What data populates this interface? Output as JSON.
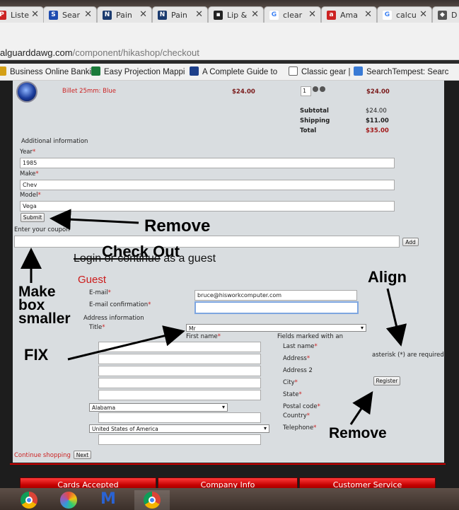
{
  "browser": {
    "tabs": [
      {
        "label": "Liste",
        "icon": "pinterest-icon",
        "color": "#cc2222"
      },
      {
        "label": "Sear",
        "icon": "search-ext-icon",
        "color": "#1d4bb0"
      },
      {
        "label": "Pain",
        "icon": "paint-icon",
        "color": "#1b3b6f"
      },
      {
        "label": "Pain",
        "icon": "paint-icon",
        "color": "#1b3b6f"
      },
      {
        "label": "Lip &",
        "icon": "dark-square-icon",
        "color": "#222222"
      },
      {
        "label": "clear",
        "icon": "google-icon",
        "color": "#4285f4"
      },
      {
        "label": "Ama",
        "icon": "amazon-icon",
        "color": "#cc2222"
      },
      {
        "label": "calcu",
        "icon": "google-icon",
        "color": "#4285f4"
      },
      {
        "label": "D",
        "icon": "car-icon",
        "color": "#555555"
      }
    ],
    "url_host": "alguarddawg.com",
    "url_path": "/component/hikashop/checkout",
    "bookmarks": [
      {
        "label": "Business Online Banki",
        "icon": "bank-icon",
        "color": "#d4a017"
      },
      {
        "label": "Easy Projection Mappi",
        "icon": "projection-icon",
        "color": "#1a7a3a"
      },
      {
        "label": "A Complete Guide to",
        "icon": "guide-icon",
        "color": "#1d3f8a"
      },
      {
        "label": "Classic gear |",
        "icon": "page-icon",
        "color": "#ffffff"
      },
      {
        "label": "SearchTempest: Searc",
        "icon": "searchtempest-icon",
        "color": "#3a7bd5"
      }
    ]
  },
  "cart": {
    "product_name": "Billet 25mm: Blue",
    "unit_price": "$24.00",
    "quantity": "1",
    "line_total": "$24.00",
    "subtotal_label": "Subtotal",
    "subtotal": "$24.00",
    "shipping_label": "Shipping",
    "shipping": "$11.00",
    "total_label": "Total",
    "total": "$35.00"
  },
  "additional": {
    "heading": "Additional information",
    "year_label": "Year",
    "year": "1985",
    "make_label": "Make",
    "make": "Chev",
    "model_label": "Model",
    "model": "Vega",
    "submit": "Submit"
  },
  "coupon": {
    "label": "Enter your coupon",
    "value": "",
    "add": "Add"
  },
  "login": {
    "struck": "Login or continue",
    "rest": " as a guest"
  },
  "guest": {
    "heading": "Guest",
    "email_label": "E-mail",
    "email": "bruce@hisworkcomputer.com",
    "email_confirm_label": "E-mail confirmation",
    "email_confirm": "",
    "address_info": "Address information",
    "title_label": "Title",
    "title_value": "Mr",
    "first_name": "First name",
    "fields_marked": "Fields marked with an",
    "last_name": "Last name",
    "address": "Address",
    "address2": "Address 2",
    "city": "City",
    "state": "State",
    "postal_code": "Postal code",
    "country": "Country",
    "telephone": "Telephone",
    "asterisk_note": "asterisk (*) are required.",
    "state_value": "Alabama",
    "country_value": "United States of America",
    "register": "Register",
    "required_mark": "*"
  },
  "nav": {
    "continue_shopping": "Continue shopping",
    "next": "Next"
  },
  "footer": [
    "Cards Accepted",
    "Company Info",
    "Customer Service"
  ],
  "annotations": {
    "remove1": "Remove",
    "check_out": "Check Out",
    "make_box": "Make",
    "make_box2": "box",
    "make_box3": "smaller",
    "align": "Align",
    "fix": "FIX",
    "remove2": "Remove"
  },
  "taskbar": [
    {
      "icon": "chrome-icon"
    },
    {
      "icon": "paint-palette-icon"
    },
    {
      "icon": "malwarebytes-icon"
    },
    {
      "icon": "chrome-icon"
    }
  ]
}
